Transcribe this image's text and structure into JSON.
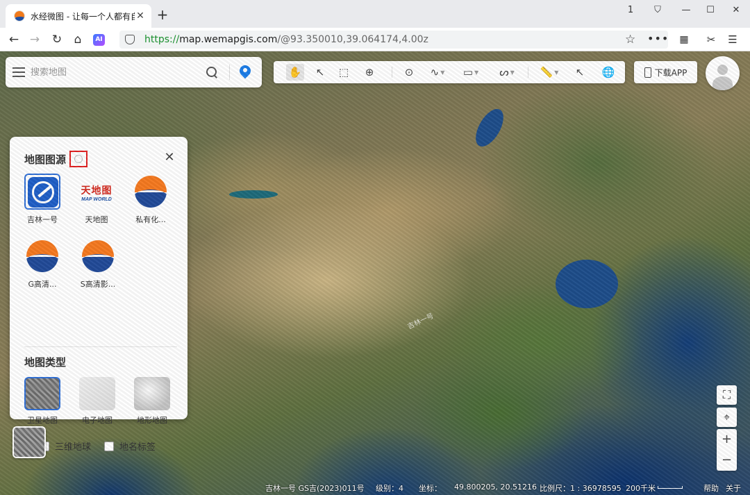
{
  "browser": {
    "tab_title": "水经微图 - 让每一个人都有自",
    "tab_close": "✕",
    "new_tab": "+",
    "url_scheme": "https://",
    "url_host": "map.wemapgis.com",
    "url_path": "/@93.350010,39.064174,4.00z",
    "window_controls": [
      "1",
      "⛉",
      "—",
      "☐",
      "✕"
    ],
    "nav_icons": [
      "arrow-left-icon",
      "arrow-right-icon",
      "reload-icon",
      "home-icon",
      "ai-icon"
    ],
    "ai_badge": "AI",
    "menu_icons": [
      "star-icon",
      "more-icon",
      "grid-icon",
      "scissors-icon",
      "menu-icon"
    ]
  },
  "search": {
    "placeholder": "搜索地图"
  },
  "toolbar": {
    "tools": [
      "pan-hand-icon",
      "select-icon",
      "box-select-icon",
      "zoom-box-icon",
      "marker-icon",
      "polyline-icon",
      "rectangle-icon",
      "route-icon",
      "measure-icon",
      "identify-icon",
      "globe-icon"
    ],
    "active_tool": "pan-hand-icon"
  },
  "download_app": {
    "label": "下载APP"
  },
  "layer_panel": {
    "source_title": "地图图源",
    "close": "✕",
    "sources": [
      {
        "label": "吉林一号",
        "selected": true
      },
      {
        "label": "天地图",
        "selected": false
      },
      {
        "label": "私有化...",
        "selected": false
      },
      {
        "label": "G高清...",
        "selected": false
      },
      {
        "label": "S高清影...",
        "selected": false
      }
    ],
    "tianditu_logo": {
      "cn": "天地图",
      "en": "MAP WORLD"
    },
    "type_title": "地图类型",
    "types": [
      {
        "label": "卫星地图",
        "selected": true
      },
      {
        "label": "电子地图",
        "selected": false
      },
      {
        "label": "地形地图",
        "selected": false
      }
    ],
    "checkboxes": [
      {
        "label": "三维地球",
        "checked": false
      },
      {
        "label": "地名标签",
        "checked": false
      }
    ]
  },
  "map_controls": {
    "zoom_in": "+",
    "zoom_out": "−"
  },
  "status_bar": {
    "attribution": "吉林一号 GS吉(2023)011号",
    "level_label": "级别：4",
    "coord_label": "坐标：",
    "coord_value": "49.800205,  20.51216",
    "scale_label": "比例尺：1 : 36978595",
    "distance": "200千米",
    "help": "帮助",
    "about": "关于"
  },
  "colors": {
    "accent": "#2f6fd6",
    "pin_blue": "#1c7de8",
    "url_green": "#1a8f2e",
    "highlight_red": "#e02020",
    "wemap_orange": "#f5791f",
    "wemap_blue": "#214a98"
  }
}
